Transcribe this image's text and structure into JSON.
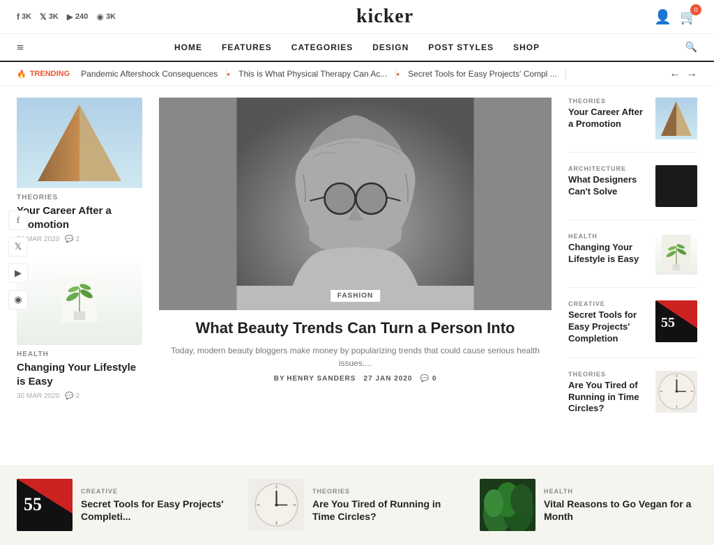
{
  "site": {
    "name": "kicker"
  },
  "social_counts": [
    {
      "platform": "facebook",
      "count": "3K",
      "icon": "f"
    },
    {
      "platform": "twitter",
      "count": "3K",
      "icon": "t"
    },
    {
      "platform": "youtube",
      "count": "240",
      "icon": "▶"
    },
    {
      "platform": "instagram",
      "count": "3K",
      "icon": "◉"
    }
  ],
  "nav": {
    "hamburger": "≡",
    "items": [
      "HOME",
      "FEATURES",
      "CATEGORIES",
      "DESIGN",
      "POST STYLES",
      "SHOP"
    ],
    "search": "🔍"
  },
  "trending": {
    "label": "TRENDING",
    "items": [
      "Pandemic Aftershock Consequences",
      "This is What Physical Therapy Can Ac...",
      "Secret Tools for Easy Projects' Compl ..."
    ]
  },
  "left_articles": [
    {
      "category": "THEORIES",
      "title": "Your Career After a Promotion",
      "date": "30 MAR 2020",
      "comments": "2",
      "thumb_type": "architecture"
    },
    {
      "category": "HEALTH",
      "title": "Changing Your Lifestyle is Easy",
      "date": "30 MAR 2020",
      "comments": "2",
      "thumb_type": "plant"
    }
  ],
  "center_article": {
    "category": "FASHION",
    "title": "What Beauty Trends Can Turn a Person Into",
    "excerpt": "Today, modern beauty bloggers make money by popularizing trends that could cause serious health issues....",
    "author": "HENRY SANDERS",
    "date": "27 JAN 2020",
    "comments": "0"
  },
  "right_articles": [
    {
      "category": "THEORIES",
      "title": "Your Career After a Promotion",
      "thumb_type": "architecture"
    },
    {
      "category": "ARCHITECTURE",
      "title": "What Designers Can't Solve",
      "thumb_type": "dark"
    },
    {
      "category": "HEALTH",
      "title": "Changing Your Lifestyle is Easy",
      "thumb_type": "plant"
    },
    {
      "category": "CREATIVE",
      "title": "Secret Tools for Easy Projects' Completion",
      "thumb_type": "red"
    },
    {
      "category": "THEORIES",
      "title": "Are You Tired of Running in Time Circles?",
      "thumb_type": "clock"
    }
  ],
  "bottom_articles": [
    {
      "category": "CREATIVE",
      "title": "Secret Tools for Easy Projects' Completi...",
      "thumb_type": "red"
    },
    {
      "category": "THEORIES",
      "title": "Are You Tired of Running in Time Circles?",
      "thumb_type": "clock"
    },
    {
      "category": "HEALTH",
      "title": "Vital Reasons to Go Vegan for a Month",
      "thumb_type": "leaves"
    }
  ],
  "social_sidebar": [
    "f",
    "t",
    "▶",
    "◉"
  ],
  "cart_count": "0",
  "by_label": "BY"
}
